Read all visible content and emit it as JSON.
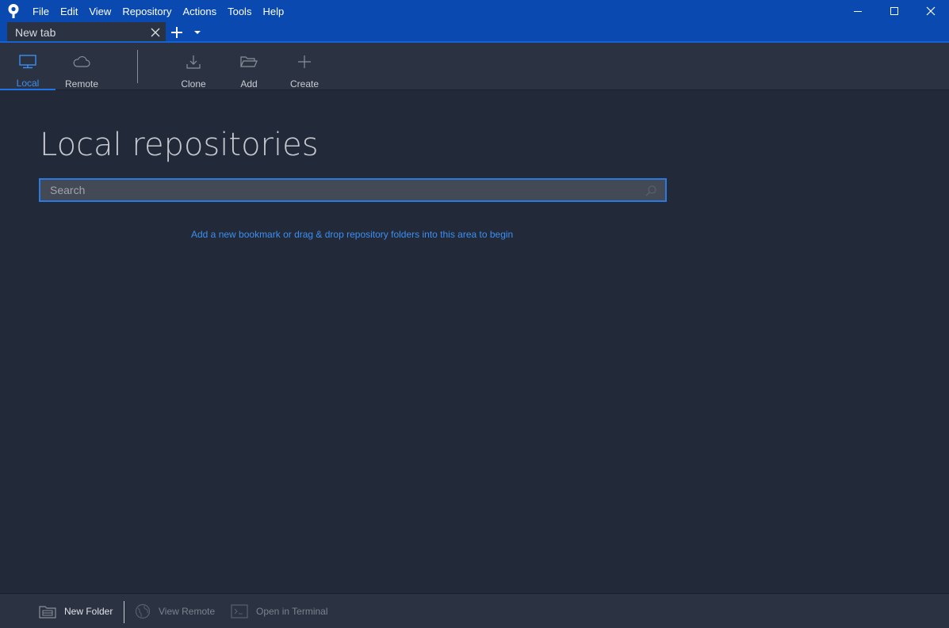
{
  "app": {
    "logo_icon": "sourcetree-logo",
    "menu": [
      "File",
      "Edit",
      "View",
      "Repository",
      "Actions",
      "Tools",
      "Help"
    ],
    "window_controls": [
      "minimize-icon",
      "maximize-icon",
      "close-icon"
    ]
  },
  "tabs": {
    "items": [
      {
        "label": "New tab"
      }
    ]
  },
  "toolbar": {
    "local": {
      "label": "Local",
      "icon": "monitor-icon",
      "active": true
    },
    "remote": {
      "label": "Remote",
      "icon": "cloud-icon"
    },
    "clone": {
      "label": "Clone",
      "icon": "download-icon"
    },
    "add": {
      "label": "Add",
      "icon": "folder-open-icon"
    },
    "create": {
      "label": "Create",
      "icon": "plus-icon"
    }
  },
  "main": {
    "title": "Local repositories",
    "search": {
      "placeholder": "Search",
      "value": ""
    },
    "empty_hint": "Add a new bookmark or drag & drop repository folders into this area to begin"
  },
  "footer": {
    "new_folder": {
      "label": "New Folder",
      "icon": "new-folder-icon"
    },
    "view_remote": {
      "label": "View Remote",
      "icon": "globe-icon",
      "disabled": true
    },
    "open_terminal": {
      "label": "Open in Terminal",
      "icon": "terminal-icon",
      "disabled": true
    }
  },
  "colors": {
    "accent": "#1e74e8",
    "titlebar": "#0a4ab0",
    "background": "#222939",
    "panel": "#2b3242",
    "link": "#3d8ff0"
  }
}
